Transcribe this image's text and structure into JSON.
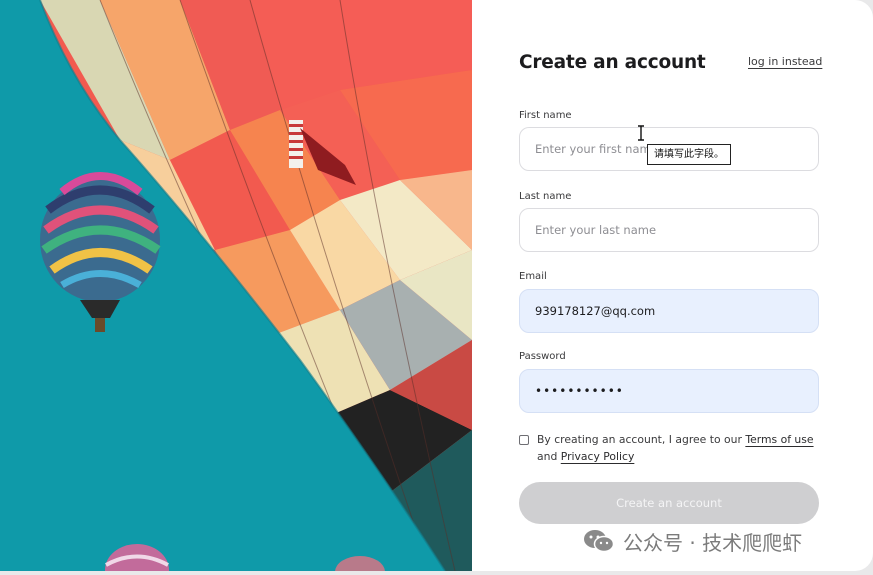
{
  "form": {
    "title": "Create an account",
    "login_link": "log in instead",
    "first_name": {
      "label": "First name",
      "placeholder": "Enter your first name",
      "value": ""
    },
    "last_name": {
      "label": "Last name",
      "placeholder": "Enter your last name",
      "value": ""
    },
    "email": {
      "label": "Email",
      "value": "939178127@qq.com"
    },
    "password": {
      "label": "Password",
      "value": "•••••••••••"
    },
    "validation_tooltip": "请填写此字段。",
    "agree": {
      "prefix": "By creating an account, I agree to our ",
      "terms": "Terms of use",
      "middle": " and ",
      "privacy": "Privacy Policy",
      "checked": false
    },
    "submit_label": "Create an account"
  },
  "watermark": {
    "text": "公众号 · 技术爬爬虾",
    "icon": "wechat-icon"
  },
  "colors": {
    "sky": "#0e97a6",
    "autofill": "#e8f0fe",
    "button_disabled": "#cfcfd1"
  }
}
